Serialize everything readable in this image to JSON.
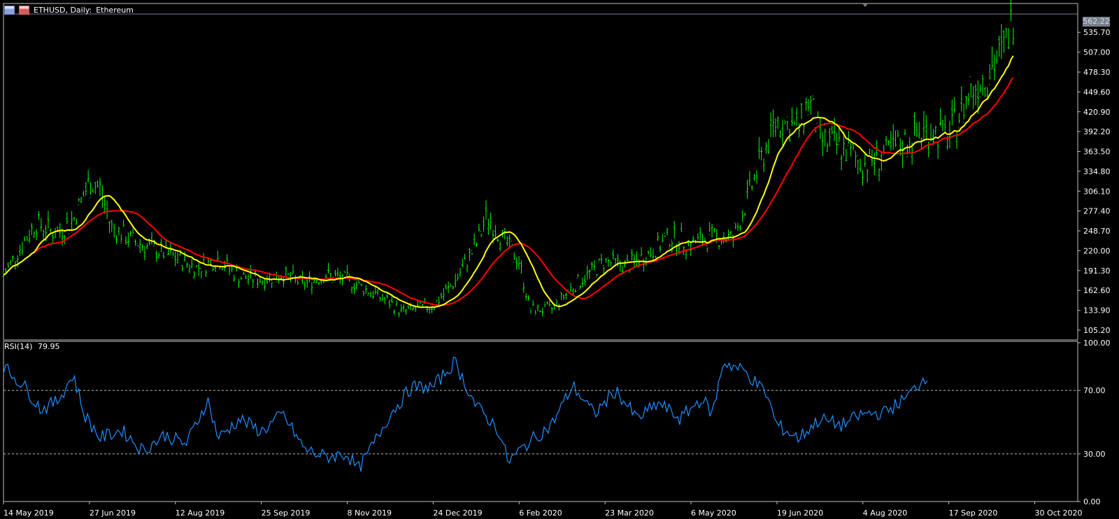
{
  "window": {
    "symbol": "ETHUSD, Daily:",
    "description": "Ethereum",
    "current_price_label": "562.22"
  },
  "indicator": {
    "name": "RSI(14)",
    "value": "79.95"
  },
  "colors": {
    "background": "#000000",
    "candles": "#00ff00",
    "ma_fast": "#ffff00",
    "ma_slow": "#ff0000",
    "rsi_line": "#1e90ff",
    "grid_axis": "#c0c0c0",
    "level_lines": "#c0c0c0"
  },
  "chart_data": [
    {
      "type": "candlestick",
      "series": [
        {
          "name": "ETHUSD Daily",
          "style": "bars"
        },
        {
          "name": "",
          "color": "#ffff00"
        },
        {
          "name": "",
          "color": "#ff0000"
        }
      ],
      "ylim": [
        92,
        562.22
      ],
      "y_ticks": [
        "535.70",
        "507.00",
        "478.30",
        "449.60",
        "420.90",
        "392.20",
        "363.50",
        "334.80",
        "306.10",
        "277.40",
        "248.70",
        "220.00",
        "191.30",
        "162.60",
        "133.90",
        "105.20"
      ],
      "x_ticks": [
        "14 May 2019",
        "27 Jun 2019",
        "12 Aug 2019",
        "25 Sep 2019",
        "8 Nov 2019",
        "24 Dec 2019",
        "6 Feb 2020",
        "23 Mar 2020",
        "6 May 2020",
        "19 Jun 2020",
        "4 Aug 2020",
        "17 Sep 2020",
        "30 Oct 2020"
      ],
      "close_path": [
        {
          "t": 0,
          "y": 185
        },
        {
          "t": 0.03,
          "y": 260
        },
        {
          "t": 0.05,
          "y": 245
        },
        {
          "t": 0.065,
          "y": 265
        },
        {
          "t": 0.08,
          "y": 320
        },
        {
          "t": 0.09,
          "y": 310
        },
        {
          "t": 0.1,
          "y": 255
        },
        {
          "t": 0.12,
          "y": 235
        },
        {
          "t": 0.14,
          "y": 222
        },
        {
          "t": 0.16,
          "y": 210
        },
        {
          "t": 0.18,
          "y": 195
        },
        {
          "t": 0.2,
          "y": 208
        },
        {
          "t": 0.22,
          "y": 182
        },
        {
          "t": 0.24,
          "y": 178
        },
        {
          "t": 0.26,
          "y": 186
        },
        {
          "t": 0.28,
          "y": 172
        },
        {
          "t": 0.3,
          "y": 185
        },
        {
          "t": 0.32,
          "y": 178
        },
        {
          "t": 0.34,
          "y": 162
        },
        {
          "t": 0.36,
          "y": 145
        },
        {
          "t": 0.37,
          "y": 132
        },
        {
          "t": 0.4,
          "y": 140
        },
        {
          "t": 0.42,
          "y": 175
        },
        {
          "t": 0.44,
          "y": 228
        },
        {
          "t": 0.45,
          "y": 270
        },
        {
          "t": 0.46,
          "y": 248
        },
        {
          "t": 0.48,
          "y": 205
        },
        {
          "t": 0.49,
          "y": 135
        },
        {
          "t": 0.51,
          "y": 135
        },
        {
          "t": 0.53,
          "y": 168
        },
        {
          "t": 0.56,
          "y": 205
        },
        {
          "t": 0.58,
          "y": 198
        },
        {
          "t": 0.6,
          "y": 215
        },
        {
          "t": 0.62,
          "y": 240
        },
        {
          "t": 0.64,
          "y": 230
        },
        {
          "t": 0.66,
          "y": 240
        },
        {
          "t": 0.68,
          "y": 238
        },
        {
          "t": 0.7,
          "y": 330
        },
        {
          "t": 0.72,
          "y": 410
        },
        {
          "t": 0.74,
          "y": 395
        },
        {
          "t": 0.75,
          "y": 440
        },
        {
          "t": 0.76,
          "y": 380
        },
        {
          "t": 0.78,
          "y": 370
        },
        {
          "t": 0.8,
          "y": 345
        },
        {
          "t": 0.82,
          "y": 358
        },
        {
          "t": 0.84,
          "y": 378
        },
        {
          "t": 0.86,
          "y": 395
        },
        {
          "t": 0.88,
          "y": 385
        },
        {
          "t": 0.9,
          "y": 450
        },
        {
          "t": 0.93,
          "y": 505
        },
        {
          "t": 0.94,
          "y": 560
        }
      ]
    },
    {
      "type": "line",
      "title": "RSI(14)",
      "ylim": [
        0,
        100
      ],
      "y_ticks": [
        "100.00",
        "70.00",
        "30.00",
        "0.00"
      ],
      "levels": [
        70,
        30
      ],
      "rsi_path": [
        {
          "t": 0,
          "y": 85
        },
        {
          "t": 0.02,
          "y": 72
        },
        {
          "t": 0.035,
          "y": 58
        },
        {
          "t": 0.05,
          "y": 63
        },
        {
          "t": 0.065,
          "y": 80
        },
        {
          "t": 0.075,
          "y": 55
        },
        {
          "t": 0.09,
          "y": 40
        },
        {
          "t": 0.11,
          "y": 45
        },
        {
          "t": 0.13,
          "y": 32
        },
        {
          "t": 0.15,
          "y": 42
        },
        {
          "t": 0.17,
          "y": 36
        },
        {
          "t": 0.19,
          "y": 64
        },
        {
          "t": 0.2,
          "y": 40
        },
        {
          "t": 0.22,
          "y": 52
        },
        {
          "t": 0.24,
          "y": 44
        },
        {
          "t": 0.26,
          "y": 55
        },
        {
          "t": 0.28,
          "y": 33
        },
        {
          "t": 0.3,
          "y": 28
        },
        {
          "t": 0.32,
          "y": 30
        },
        {
          "t": 0.33,
          "y": 20
        },
        {
          "t": 0.34,
          "y": 31
        },
        {
          "t": 0.36,
          "y": 55
        },
        {
          "t": 0.38,
          "y": 72
        },
        {
          "t": 0.4,
          "y": 72
        },
        {
          "t": 0.42,
          "y": 88
        },
        {
          "t": 0.44,
          "y": 60
        },
        {
          "t": 0.46,
          "y": 46
        },
        {
          "t": 0.47,
          "y": 25
        },
        {
          "t": 0.49,
          "y": 38
        },
        {
          "t": 0.51,
          "y": 48
        },
        {
          "t": 0.53,
          "y": 73
        },
        {
          "t": 0.55,
          "y": 55
        },
        {
          "t": 0.57,
          "y": 70
        },
        {
          "t": 0.59,
          "y": 52
        },
        {
          "t": 0.61,
          "y": 62
        },
        {
          "t": 0.63,
          "y": 52
        },
        {
          "t": 0.65,
          "y": 65
        },
        {
          "t": 0.66,
          "y": 55
        },
        {
          "t": 0.67,
          "y": 88
        },
        {
          "t": 0.69,
          "y": 82
        },
        {
          "t": 0.71,
          "y": 68
        },
        {
          "t": 0.72,
          "y": 48
        },
        {
          "t": 0.74,
          "y": 40
        },
        {
          "t": 0.76,
          "y": 52
        },
        {
          "t": 0.78,
          "y": 48
        },
        {
          "t": 0.8,
          "y": 55
        },
        {
          "t": 0.82,
          "y": 56
        },
        {
          "t": 0.84,
          "y": 65
        },
        {
          "t": 0.86,
          "y": 80
        }
      ]
    }
  ]
}
